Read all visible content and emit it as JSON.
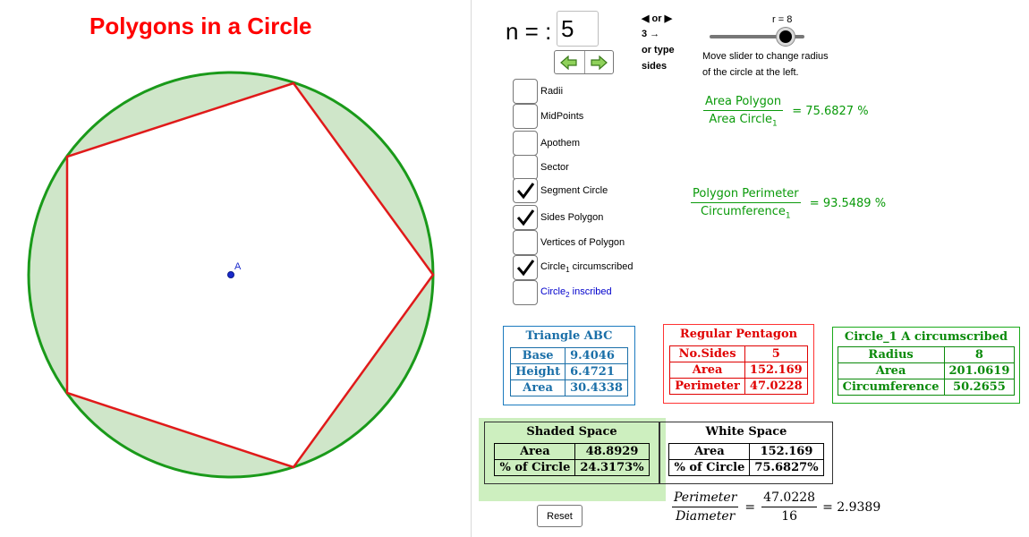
{
  "title": "Polygons in a Circle",
  "point_label": "A",
  "n_label": "n = :",
  "n_value": "5",
  "arrow_icons": [
    "left-arrow-icon",
    "right-arrow-icon"
  ],
  "hints": [
    "◀ or ▶",
    "3 →",
    "or type",
    "sides"
  ],
  "slider": {
    "label": "r = 8",
    "value": 8,
    "level": 0.8,
    "note_1": "Move slider to change radius",
    "note_2": "of the circle at the left."
  },
  "checkboxes": [
    {
      "label": "Radii",
      "checked": false
    },
    {
      "label": "MidPoints",
      "checked": false
    },
    {
      "label": "Apothem",
      "checked": false
    },
    {
      "label": "Sector",
      "checked": false
    },
    {
      "label": "Segment Circle",
      "checked": true
    },
    {
      "label": "Sides Polygon",
      "checked": true
    },
    {
      "label": "Vertices of Polygon",
      "checked": false
    },
    {
      "label": "Circle",
      "sub": "1",
      "label_rest": " circumscribed",
      "checked": true
    },
    {
      "label": "Circle",
      "sub": "2",
      "label_rest": " inscribed",
      "checked": false
    }
  ],
  "area_ratio": {
    "numerator": "Area Polygon",
    "denominator": "Area Circle",
    "den_sub": "1",
    "value": "= 75.6827 %"
  },
  "perimeter_ratio": {
    "numerator": "Polygon Perimeter",
    "denominator": "Circumference",
    "den_sub": "1",
    "value": "= 93.5489 %"
  },
  "triangle_table": {
    "title": "Triangle ABC",
    "rows": [
      [
        "Base",
        "9.4046"
      ],
      [
        "Height",
        "6.4721"
      ],
      [
        "Area",
        "30.4338"
      ]
    ]
  },
  "pentagon_table": {
    "title": "Regular Pentagon",
    "rows": [
      [
        "No.Sides",
        "5"
      ],
      [
        "Area",
        "152.169"
      ],
      [
        "Perimeter",
        "47.0228"
      ]
    ]
  },
  "circle_table": {
    "title": "Circle_1 A circumscribed",
    "rows": [
      [
        "Radius",
        "8"
      ],
      [
        "Area",
        "201.0619"
      ],
      [
        "Circumference",
        "50.2655"
      ]
    ]
  },
  "shaded_table": {
    "title": "Shaded Space",
    "rows": [
      [
        "Area",
        "48.8929"
      ],
      [
        "% of Circle",
        "24.3173%"
      ]
    ]
  },
  "white_table": {
    "title": "White Space",
    "rows": [
      [
        "Area",
        "152.169"
      ],
      [
        "% of Circle",
        "75.6827%"
      ]
    ]
  },
  "pd_formula": {
    "numerator": "Perimeter",
    "denominator": "Diameter",
    "eq1": "=",
    "num_value": "47.0228",
    "den_value": "16",
    "result": "= 2.9389"
  },
  "reset_label": "Reset",
  "colors": {
    "title": "#ff0000",
    "circle": "#1a9a1a",
    "segment_fill": "#cfe6c9",
    "polygon": "#e01a1a",
    "point": "#1a2acc",
    "shaded": "#cdefbf"
  }
}
